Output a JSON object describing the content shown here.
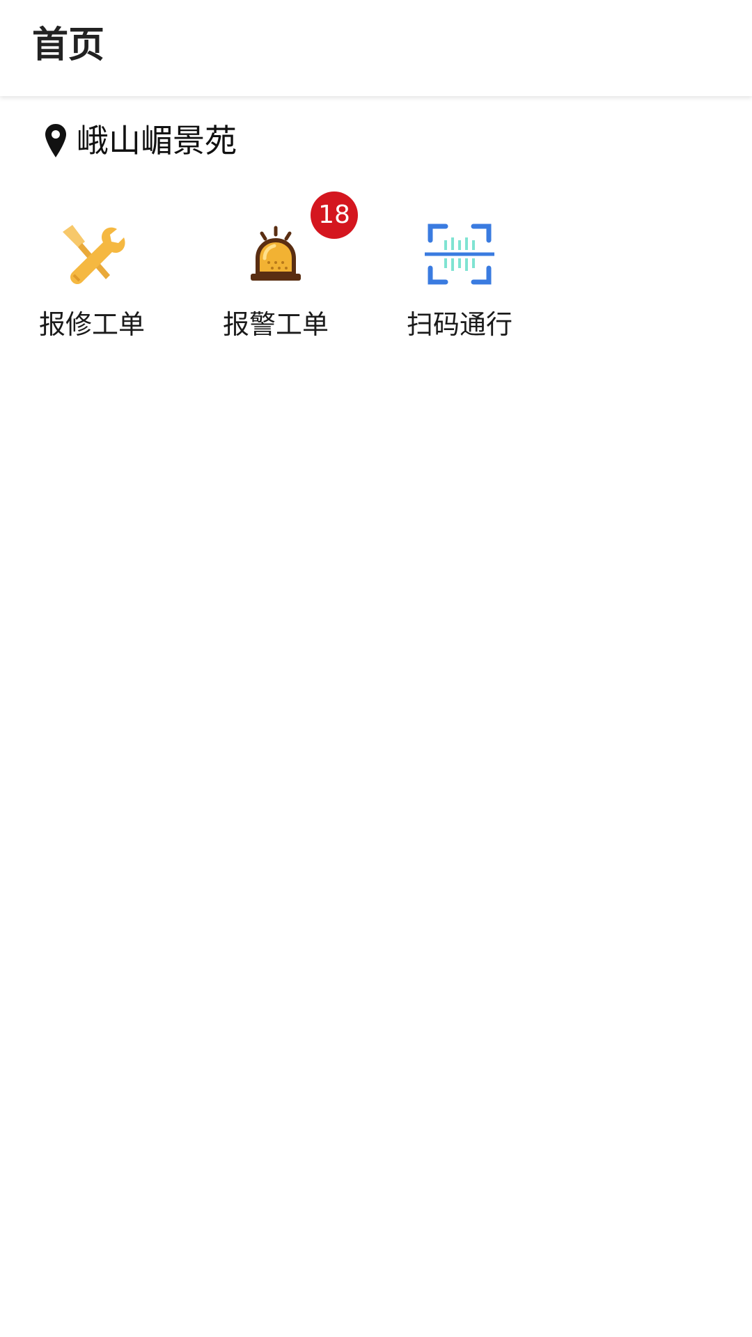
{
  "header": {
    "title": "首页"
  },
  "location": {
    "icon": "location-pin-icon",
    "name": "峨山嵋景苑"
  },
  "menu": [
    {
      "label": "报修工单",
      "icon": "repair-tools-icon",
      "icon_color": "#F5B841"
    },
    {
      "label": "报警工单",
      "icon": "alarm-siren-icon",
      "icon_color": "#F2B233",
      "badge": "18"
    },
    {
      "label": "扫码通行",
      "icon": "scan-code-icon",
      "icon_color": "#3A7BE0"
    }
  ],
  "colors": {
    "badge": "#D4161F",
    "scan_accent": "#7FE3D2"
  }
}
